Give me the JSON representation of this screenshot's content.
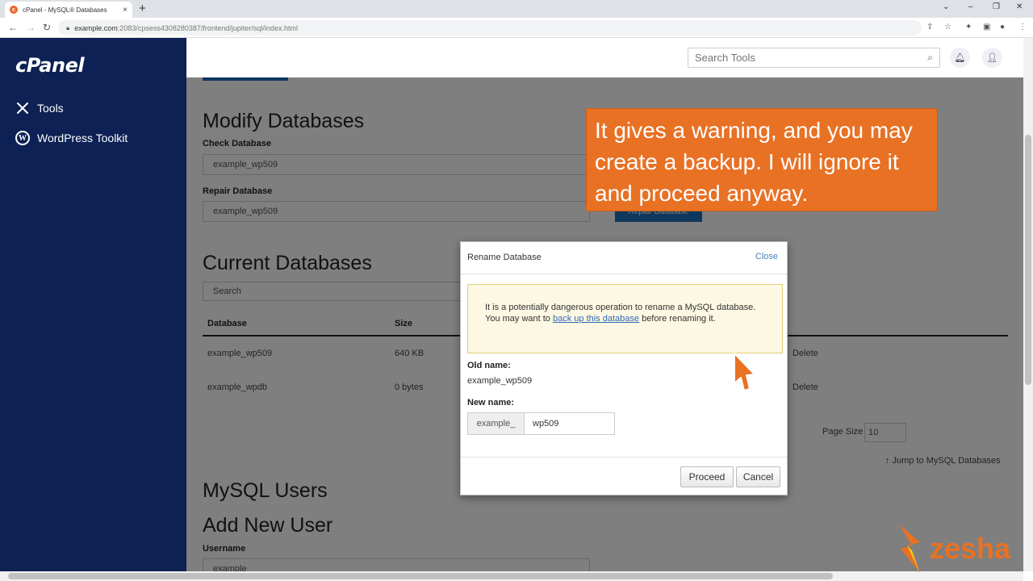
{
  "browser": {
    "tab_title": "cPanel - MySQL® Databases",
    "tab_close": "×",
    "new_tab": "+",
    "url_host": "example.com",
    "url_path": ":2083/cpsess4308280387/frontend/jupiter/sql/index.html"
  },
  "sidebar": {
    "logo": "cPanel",
    "items": [
      {
        "label": "Tools",
        "icon": "tools-icon"
      },
      {
        "label": "WordPress Toolkit",
        "icon": "wordpress-icon"
      }
    ]
  },
  "header": {
    "search_placeholder": "Search Tools"
  },
  "main": {
    "modify_title": "Modify Databases",
    "check_label": "Check Database",
    "check_value": "example_wp509",
    "repair_label": "Repair Database",
    "repair_value": "example_wp509",
    "repair_button": "Repair Database",
    "current_title": "Current Databases",
    "search_placeholder": "Search",
    "table_headers": [
      "Database",
      "Size"
    ],
    "rows": [
      {
        "database": "example_wp509",
        "size": "640 KB",
        "action": "Delete"
      },
      {
        "database": "example_wpdb",
        "size": "0 bytes",
        "action": "Delete"
      }
    ],
    "page_size_label": "Page Size",
    "page_size_value": "10",
    "jump_link": "↑ Jump to MySQL Databases",
    "users_title": "MySQL Users",
    "add_user_title": "Add New User",
    "username_label": "Username",
    "username_value": "example_"
  },
  "modal": {
    "title": "Rename Database",
    "close": "Close",
    "warning_before": "It is a potentially dangerous operation to rename a MySQL database. You may want to ",
    "warning_link": "back up this database",
    "warning_after": " before renaming it.",
    "old_name_label": "Old name:",
    "old_name_value": "example_wp509",
    "new_name_label": "New name:",
    "new_name_prefix": "example_",
    "new_name_value": "wp509",
    "proceed": "Proceed",
    "cancel": "Cancel"
  },
  "annotation": {
    "text": "It gives a warning, and you may create a backup. I will ignore it and proceed anyway.",
    "color": "#e87124"
  },
  "watermark": {
    "text": "zesha"
  }
}
